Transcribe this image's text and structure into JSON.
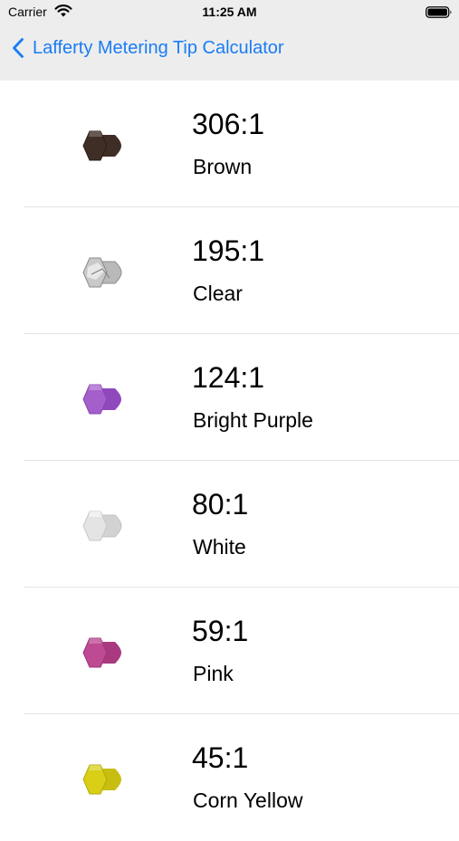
{
  "status_bar": {
    "carrier": "Carrier",
    "time": "11:25 AM",
    "wifi_icon": "wifi-icon",
    "battery_icon": "battery-icon"
  },
  "nav": {
    "back_label": "Lafferty Metering Tip Calculator",
    "back_icon": "chevron-left-icon",
    "accent_color": "#1a7cf5"
  },
  "tips": [
    {
      "ratio": "306:1",
      "name": "Brown",
      "color": "#3f2e25",
      "icon": "metering-tip-brown-icon"
    },
    {
      "ratio": "195:1",
      "name": "Clear",
      "color": "#a9a9a9",
      "icon": "metering-tip-clear-icon"
    },
    {
      "ratio": "124:1",
      "name": "Bright Purple",
      "color": "#a45fcb",
      "icon": "metering-tip-bright-purple-icon"
    },
    {
      "ratio": "80:1",
      "name": "White",
      "color": "#dedede",
      "icon": "metering-tip-white-icon"
    },
    {
      "ratio": "59:1",
      "name": "Pink",
      "color": "#bd4a93",
      "icon": "metering-tip-pink-icon"
    },
    {
      "ratio": "45:1",
      "name": "Corn Yellow",
      "color": "#d8cf16",
      "icon": "metering-tip-corn-yellow-icon"
    }
  ]
}
